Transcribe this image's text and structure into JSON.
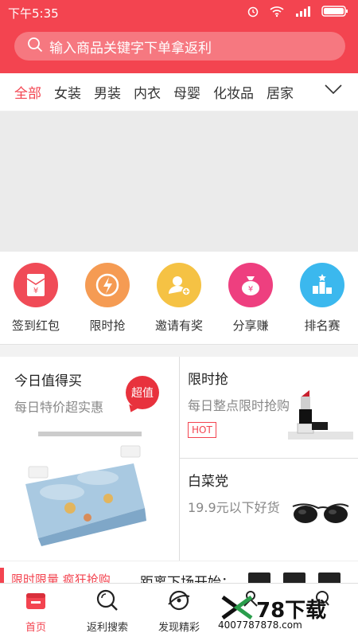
{
  "status_bar": {
    "time": "下午5:35"
  },
  "search": {
    "placeholder": "输入商品关键字下单拿返利"
  },
  "categories": [
    "全部",
    "女装",
    "男装",
    "内衣",
    "母婴",
    "化妆品",
    "居家"
  ],
  "quick_actions": [
    {
      "label": "签到红包",
      "icon": "red-envelope-icon",
      "color": "#f04b57"
    },
    {
      "label": "限时抢",
      "icon": "lightning-icon",
      "color": "#f59b53"
    },
    {
      "label": "邀请有奖",
      "icon": "invite-user-icon",
      "color": "#f5c244"
    },
    {
      "label": "分享赚",
      "icon": "money-bag-icon",
      "color": "#ee3f7f"
    },
    {
      "label": "排名赛",
      "icon": "ranking-icon",
      "color": "#3bb8ee"
    }
  ],
  "promo": {
    "left": {
      "title": "今日值得买",
      "subtitle": "每日特价超实惠",
      "badge": "超值"
    },
    "right_top": {
      "title": "限时抢",
      "subtitle": "每日整点限时抢购",
      "tag": "HOT"
    },
    "right_bottom": {
      "title": "白菜党",
      "subtitle": "19.9元以下好货"
    }
  },
  "flash_strip": {
    "label": "限时限量 疯狂抢购",
    "countdown_label": "距离下场开始："
  },
  "tabs": [
    {
      "label": "首页",
      "icon": "home-icon",
      "active": true
    },
    {
      "label": "返利搜索",
      "icon": "search-icon",
      "active": false
    },
    {
      "label": "发现精彩",
      "icon": "discover-icon",
      "active": false
    },
    {
      "label": "",
      "icon": "person-icon",
      "active": false
    },
    {
      "label": "",
      "icon": "profile-icon",
      "active": false
    }
  ],
  "watermark": {
    "brand": "78下载",
    "url": "4007787878.com"
  },
  "colors": {
    "brand": "#f34450",
    "banner": "#ebebeb"
  }
}
